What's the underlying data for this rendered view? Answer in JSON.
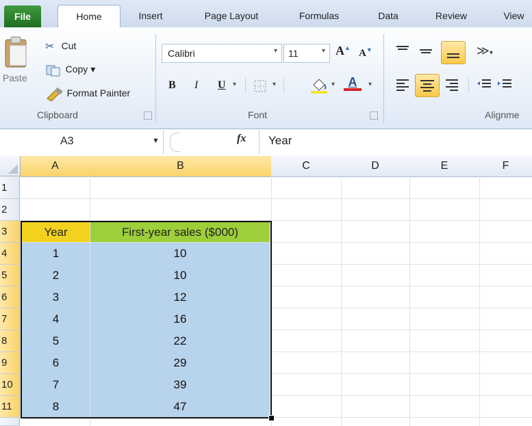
{
  "ribbon": {
    "tabs": [
      "File",
      "Home",
      "Insert",
      "Page Layout",
      "Formulas",
      "Data",
      "Review",
      "View"
    ],
    "clipboard": {
      "paste": "Paste",
      "cut": "Cut",
      "copy": "Copy ▾",
      "format_painter": "Format Painter",
      "group": "Clipboard"
    },
    "font": {
      "name": "Calibri",
      "size": "11",
      "bold": "B",
      "italic": "I",
      "underline": "U",
      "group": "Font"
    },
    "alignment": {
      "group": "Alignme"
    }
  },
  "formula_bar": {
    "cell_ref": "A3",
    "fx": "fx",
    "content": "Year"
  },
  "columns": [
    "A",
    "B",
    "C",
    "D",
    "E",
    "F"
  ],
  "rows": [
    "1",
    "2",
    "3",
    "4",
    "5",
    "6",
    "7",
    "8",
    "9",
    "10",
    "11"
  ],
  "table": {
    "headers": [
      "Year",
      "First-year sales ($000)"
    ],
    "data": [
      [
        "1",
        "10"
      ],
      [
        "2",
        "10"
      ],
      [
        "3",
        "12"
      ],
      [
        "4",
        "16"
      ],
      [
        "5",
        "22"
      ],
      [
        "6",
        "29"
      ],
      [
        "7",
        "39"
      ],
      [
        "8",
        "47"
      ]
    ]
  },
  "colors": {
    "header_fill": "#f2d21f",
    "header2_fill": "#9dcf3a",
    "selection": "#b8d3ec",
    "accent_sel": "#f9d36a"
  }
}
